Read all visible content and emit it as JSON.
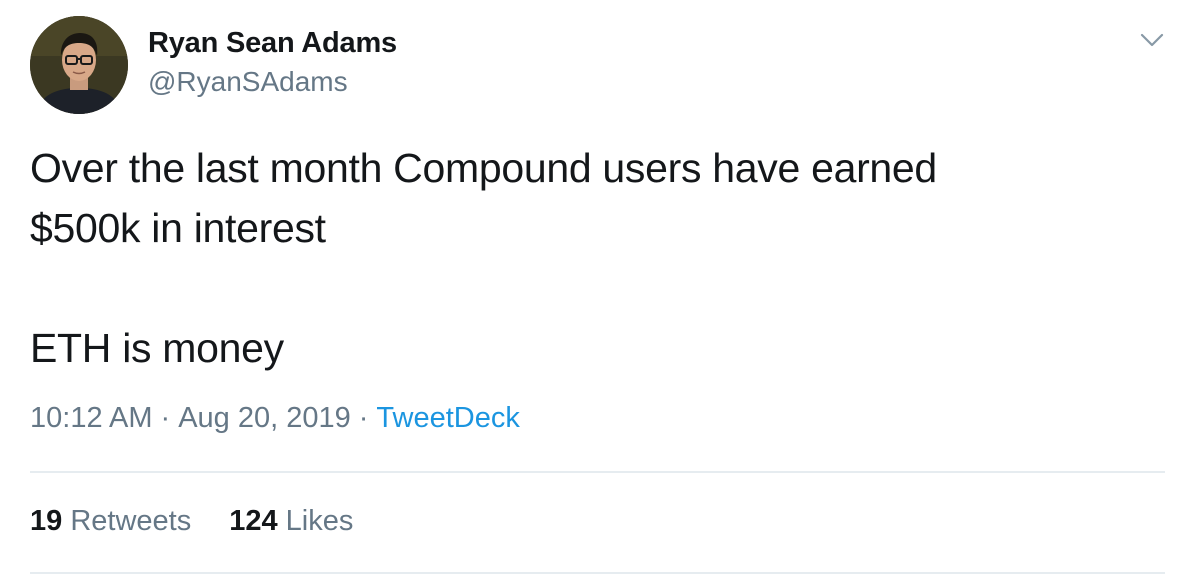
{
  "tweet": {
    "author": {
      "display_name": "Ryan Sean Adams",
      "handle": "@RyanSAdams",
      "avatar_icon": "profile-photo"
    },
    "menu_icon": "chevron-down-icon",
    "text_lines": [
      "Over the last month Compound users have earned",
      "$500k in interest",
      "ETH is money"
    ],
    "meta": {
      "time": "10:12 AM",
      "separator": "·",
      "date": "Aug 20, 2019",
      "source": "TweetDeck"
    },
    "stats": {
      "retweets_count": "19",
      "retweets_label": "Retweets",
      "likes_count": "124",
      "likes_label": "Likes"
    },
    "colors": {
      "text": "#14171a",
      "secondary": "#657786",
      "link": "#1b95e0",
      "divider": "#e6ecf0"
    }
  }
}
